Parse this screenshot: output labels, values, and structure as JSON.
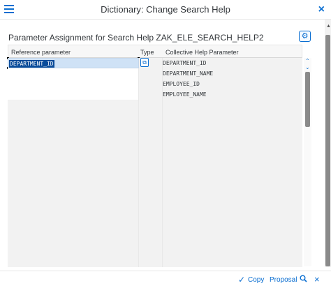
{
  "dialog": {
    "title": "Dictionary: Change Search Help",
    "close_label": "×"
  },
  "section": {
    "title": "Parameter Assignment for Search Help ZAK_ELE_SEARCH_HELP2"
  },
  "table": {
    "columns": [
      "Reference parameter",
      "Type",
      "Collective Help Parameter"
    ],
    "rows": [
      {
        "reference": "DEPARTMENT_ID",
        "collective": "DEPARTMENT_ID"
      },
      {
        "reference": "",
        "collective": "DEPARTMENT_NAME"
      },
      {
        "reference": "",
        "collective": "EMPLOYEE_ID"
      },
      {
        "reference": "",
        "collective": "EMPLOYEE_NAME"
      }
    ]
  },
  "footer": {
    "copy_label": "Copy",
    "proposal_label": "Proposal"
  },
  "icons": {
    "menu": "hamburger-icon",
    "close": "close-icon",
    "settings": "gear-icon",
    "type_help": "value-help-icon",
    "copy": "check-icon",
    "search": "search-icon",
    "cancel": "cancel-icon"
  },
  "colors": {
    "accent": "#0a6ed1",
    "selection": "#0a4c9a"
  }
}
